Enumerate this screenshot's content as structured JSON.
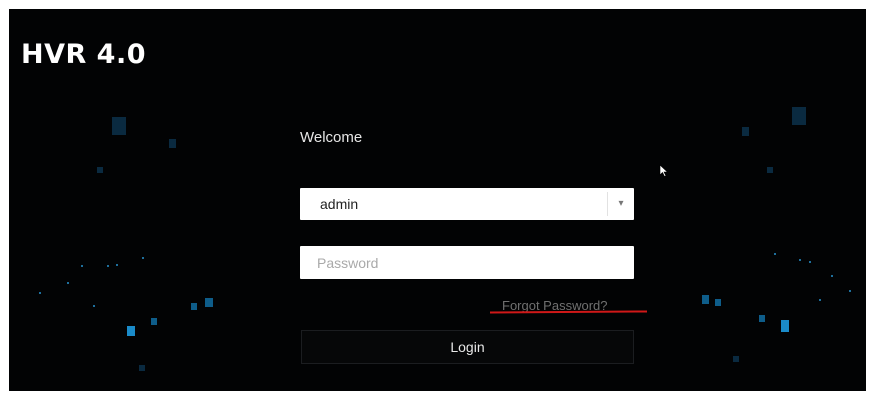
{
  "app": {
    "logo_text": "HVR 4.0"
  },
  "login": {
    "welcome_text": "Welcome",
    "username_value": "admin",
    "password_placeholder": "Password",
    "forgot_password_label": "Forgot Password?",
    "login_button_label": "Login"
  },
  "colors": {
    "background": "#020304",
    "accent_blue": "#1a8bc9",
    "annotation_red": "#d01818"
  },
  "icons": {
    "dropdown": "chevron-down-icon",
    "cursor": "mouse-pointer-icon"
  }
}
